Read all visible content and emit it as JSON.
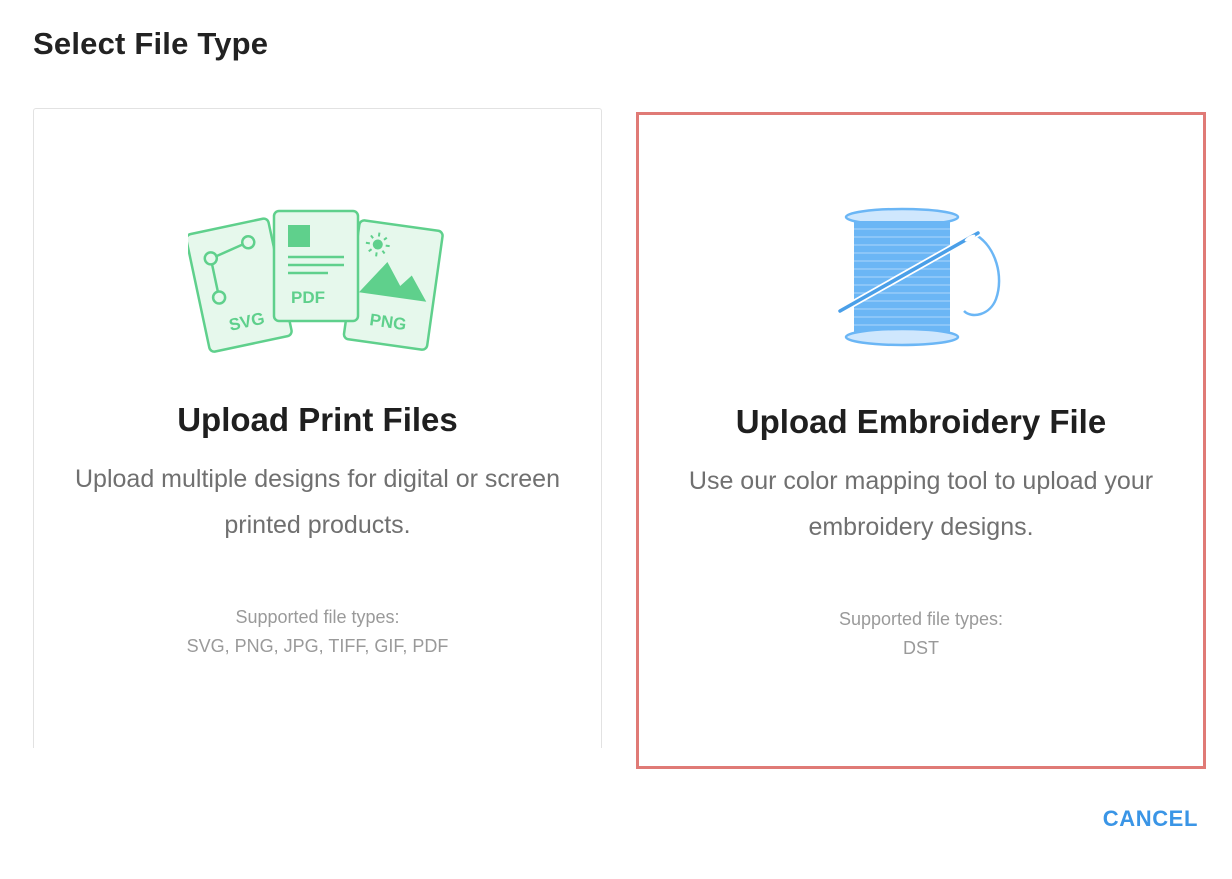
{
  "dialog": {
    "title": "Select File Type"
  },
  "cards": [
    {
      "title": "Upload Print Files",
      "description": "Upload multiple designs for digital or screen printed products.",
      "supported_label": "Supported file types:",
      "supported_types": "SVG, PNG, JPG, TIFF, GIF, PDF",
      "icon": "print-files-icon",
      "icon_labels": [
        "SVG",
        "PDF",
        "PNG"
      ]
    },
    {
      "title": "Upload Embroidery File",
      "description": "Use our color mapping tool to upload your embroidery designs.",
      "supported_label": "Supported file types:",
      "supported_types": "DST",
      "icon": "thread-spool-icon",
      "selected": true
    }
  ],
  "footer": {
    "cancel_label": "CANCEL"
  },
  "colors": {
    "print_icon_green": "#5fd08c",
    "print_icon_fill": "#e6f8ec",
    "spool_blue": "#6bb6f5",
    "selection_border": "#e07a76",
    "cancel_blue": "#3a95e6"
  }
}
